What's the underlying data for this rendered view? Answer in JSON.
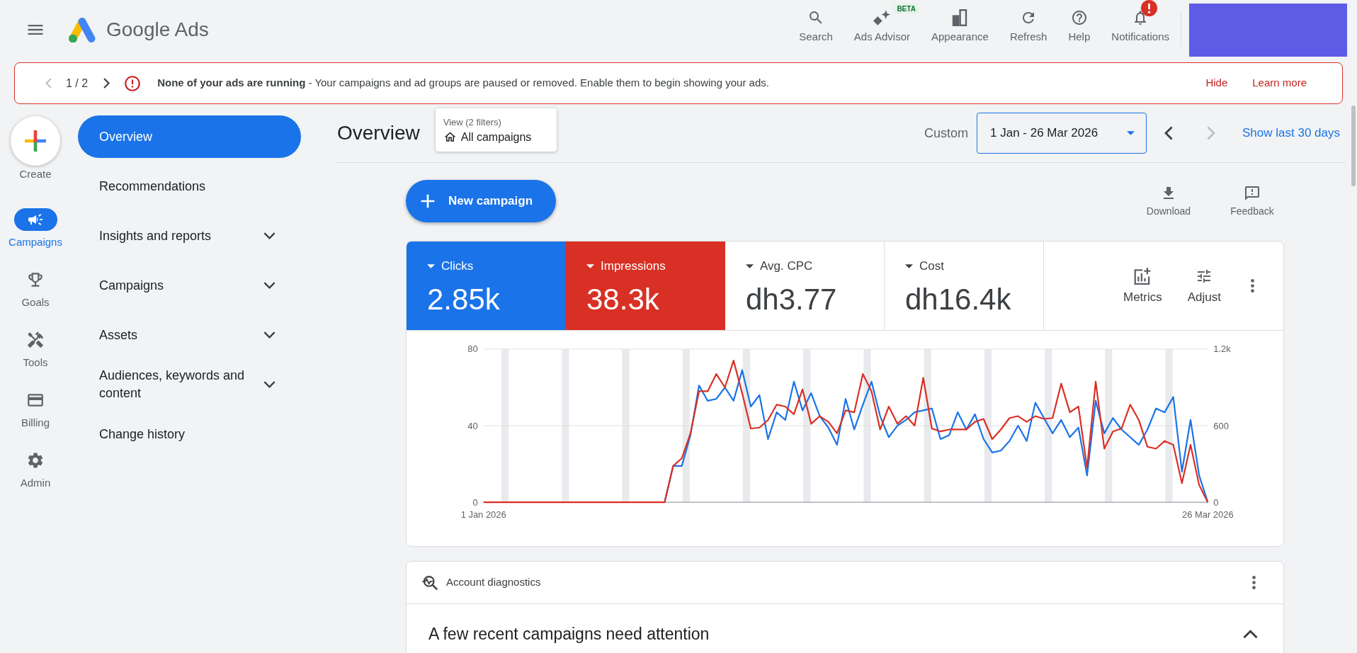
{
  "topbar": {
    "product": "Google Ads",
    "tools": [
      {
        "label": "Search",
        "alert": false
      },
      {
        "label": "Ads Advisor",
        "badge": "BETA",
        "alert": false
      },
      {
        "label": "Appearance",
        "alert": false
      },
      {
        "label": "Refresh",
        "alert": false
      },
      {
        "label": "Help",
        "alert": false
      },
      {
        "label": "Notifications",
        "alert": true
      }
    ]
  },
  "alert_banner": {
    "pager": "1 / 2",
    "prev_disabled": true,
    "next_disabled": false,
    "message": "**None of your ads are running** - Your campaigns and ad groups are paused or removed. Enable them to begin showing your ads.",
    "actions": [
      "Hide",
      "Learn more"
    ]
  },
  "rail": {
    "create_label": "Create",
    "items": [
      {
        "label": "Campaigns",
        "selected": true
      },
      {
        "label": "Goals",
        "selected": false
      },
      {
        "label": "Tools",
        "selected": false
      },
      {
        "label": "Billing",
        "selected": false
      },
      {
        "label": "Admin",
        "selected": false
      }
    ]
  },
  "nav": [
    {
      "label": "Overview",
      "kind": "link",
      "selected": true
    },
    {
      "label": "Recommendations",
      "kind": "link",
      "selected": false
    },
    {
      "label": "Insights and reports",
      "kind": "group",
      "selected": false,
      "expanded": false
    },
    {
      "label": "Campaigns",
      "kind": "group",
      "selected": false,
      "expanded": false
    },
    {
      "label": "Assets",
      "kind": "group",
      "selected": false,
      "expanded": false
    },
    {
      "label": "Audiences, keywords and content",
      "kind": "group",
      "selected": false,
      "expanded": false
    },
    {
      "label": "Change history",
      "kind": "link",
      "selected": false
    }
  ],
  "header": {
    "title": "Overview",
    "view": {
      "caption": "View (2 filters)",
      "value": "All campaigns"
    },
    "date": {
      "label": "Custom",
      "value": "1 Jan - 26 Mar 2026",
      "prev_disabled": false,
      "next_disabled": true
    },
    "shortcut": "Show last 30 days"
  },
  "actions": {
    "primary": "New campaign",
    "tools": [
      "Download",
      "Feedback"
    ]
  },
  "performance": {
    "metrics": [
      {
        "label": "Clicks",
        "value": "2.85k",
        "selected": true,
        "color": "#1a73e8"
      },
      {
        "label": "Impressions",
        "value": "38.3k",
        "selected": true,
        "color": "#d93025"
      },
      {
        "label": "Avg. CPC",
        "value": "dh3.77",
        "selected": false
      },
      {
        "label": "Cost",
        "value": "dh16.4k",
        "selected": false
      }
    ],
    "tools": [
      "Metrics",
      "Adjust"
    ],
    "chart_data": {
      "type": "line",
      "categories": [
        "1 Jan 2026",
        null,
        null,
        null,
        null,
        null,
        null,
        null,
        null,
        null,
        null,
        null,
        null,
        null,
        null,
        null,
        null,
        null,
        null,
        null,
        null,
        null,
        null,
        null,
        null,
        null,
        null,
        null,
        null,
        null,
        null,
        null,
        null,
        null,
        null,
        null,
        null,
        null,
        null,
        null,
        null,
        null,
        null,
        null,
        null,
        null,
        null,
        null,
        null,
        null,
        null,
        null,
        null,
        null,
        null,
        null,
        null,
        null,
        null,
        null,
        null,
        null,
        null,
        null,
        null,
        null,
        null,
        null,
        null,
        null,
        null,
        null,
        null,
        null,
        null,
        null,
        null,
        null,
        null,
        null,
        null,
        null,
        null,
        null,
        "26 Mar 2026"
      ],
      "ylim": [
        0,
        80
      ],
      "yticks": [
        0,
        40,
        80
      ],
      "y2lim": [
        0,
        1200
      ],
      "y2ticks": [
        0,
        600,
        {
          "value": 1200,
          "label": "1.2k"
        }
      ],
      "series": [
        {
          "color": "#1a73e8",
          "values": [
            null,
            null,
            null,
            null,
            null,
            null,
            null,
            null,
            null,
            null,
            null,
            null,
            null,
            null,
            null,
            null,
            null,
            null,
            null,
            null,
            null,
            0,
            19,
            19,
            35,
            61,
            53,
            54,
            60,
            53,
            69,
            50,
            56,
            33,
            47,
            43,
            63,
            48,
            57,
            45,
            39,
            30,
            54,
            38,
            51,
            63,
            45,
            34,
            40,
            43,
            47,
            48,
            49,
            33,
            35,
            47,
            38,
            46,
            33,
            26,
            27,
            32,
            40,
            32,
            52,
            44,
            36,
            43,
            34,
            39,
            14,
            53,
            36,
            44,
            38,
            34,
            30,
            38,
            49,
            47,
            55,
            16,
            43,
            14,
            0
          ]
        },
        {
          "color": "#d93025",
          "axis": "y2",
          "values": [
            0,
            0,
            0,
            0,
            0,
            0,
            0,
            0,
            0,
            0,
            0,
            0,
            0,
            0,
            0,
            0,
            0,
            0,
            0,
            0,
            0,
            0,
            285,
            345,
            540,
            870,
            870,
            1005,
            900,
            1110,
            855,
            578,
            585,
            645,
            765,
            750,
            690,
            885,
            615,
            675,
            630,
            540,
            720,
            705,
            1005,
            870,
            570,
            750,
            615,
            675,
            600,
            975,
            578,
            555,
            570,
            570,
            570,
            630,
            653,
            495,
            570,
            660,
            675,
            630,
            675,
            653,
            660,
            930,
            705,
            750,
            270,
            945,
            420,
            555,
            578,
            765,
            645,
            435,
            420,
            480,
            450,
            150,
            450,
            135,
            0
          ]
        }
      ]
    }
  },
  "diagnostics": {
    "title": "Account diagnostics",
    "heading": "A few recent campaigns need attention",
    "expanded": true
  }
}
